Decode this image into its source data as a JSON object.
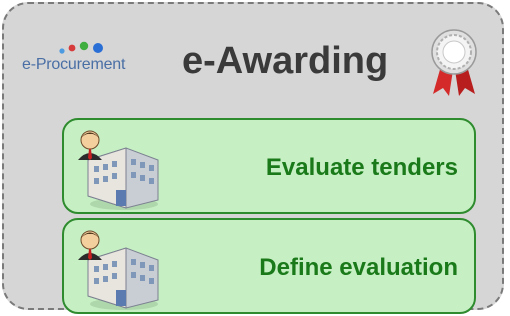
{
  "header": {
    "logo_text": "e-Procurement",
    "title": "e-Awarding",
    "logo_icon": "colored-dots-icon",
    "badge_icon": "award-rosette-icon"
  },
  "steps": [
    {
      "label": "Evaluate tenders",
      "icon": "office-building-with-person-icon"
    },
    {
      "label": "Define evaluation",
      "icon": "office-building-with-person-icon"
    }
  ],
  "colors": {
    "panel_background": "#d6d6d6",
    "card_background": "#c6efc3",
    "card_border": "#2e8b2e",
    "card_text": "#1a7a1a",
    "title_text": "#3a3a3a",
    "logo_text": "#4a6fa5"
  }
}
